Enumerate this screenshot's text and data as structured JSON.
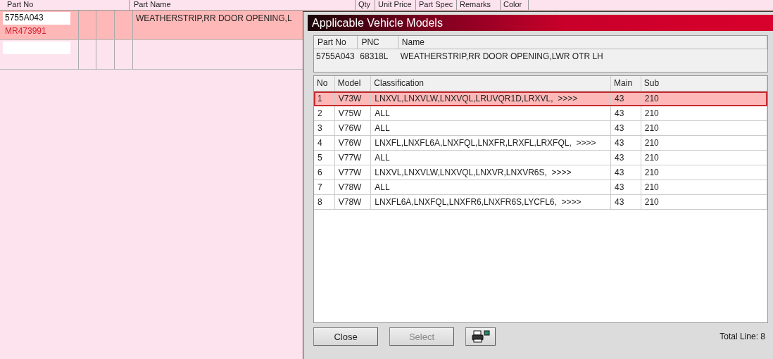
{
  "background_table": {
    "columns": [
      "Part No",
      "Part Name",
      "Qty",
      "Unit Price",
      "Part Spec",
      "Remarks",
      "Color"
    ],
    "rows": [
      {
        "part_no": "5755A043",
        "alt_part_no": "MR473991",
        "part_name": "WEATHERSTRIP,RR DOOR OPENING,L",
        "selected": true
      },
      {
        "selected": false
      }
    ]
  },
  "dialog": {
    "title": "Applicable Vehicle Models",
    "part_info": {
      "columns": [
        "Part No",
        "PNC",
        "Name"
      ],
      "values": [
        "5755A043",
        "68318L",
        "WEATHERSTRIP,RR DOOR OPENING,LWR OTR LH"
      ]
    },
    "grid": {
      "columns": [
        "No",
        "Model",
        "Classification",
        "Main",
        "Sub"
      ],
      "rows": [
        {
          "cells": [
            "1",
            "V73W",
            "LNXVL,LNXVLW,LNXVQL,LRUVQR1D,LRXVL,  >>>>",
            "43",
            "210"
          ],
          "selected": true
        },
        {
          "cells": [
            "2",
            "V75W",
            "ALL",
            "43",
            "210"
          ],
          "selected": false
        },
        {
          "cells": [
            "3",
            "V76W",
            "ALL",
            "43",
            "210"
          ],
          "selected": false
        },
        {
          "cells": [
            "4",
            "V76W",
            "LNXFL,LNXFL6A,LNXFQL,LNXFR,LRXFL,LRXFQL,  >>>>",
            "43",
            "210"
          ],
          "selected": false
        },
        {
          "cells": [
            "5",
            "V77W",
            "ALL",
            "43",
            "210"
          ],
          "selected": false
        },
        {
          "cells": [
            "6",
            "V77W",
            "LNXVL,LNXVLW,LNXVQL,LNXVR,LNXVR6S,  >>>>",
            "43",
            "210"
          ],
          "selected": false
        },
        {
          "cells": [
            "7",
            "V78W",
            "ALL",
            "43",
            "210"
          ],
          "selected": false
        },
        {
          "cells": [
            "8",
            "V78W",
            "LNXFL6A,LNXFQL,LNXFR6,LNXFR6S,LYCFL6,  >>>>",
            "43",
            "210"
          ],
          "selected": false
        }
      ]
    },
    "buttons": [
      {
        "label": "Close",
        "disabled": false
      },
      {
        "label": "Select",
        "disabled": true
      }
    ],
    "total": "Total Line: 8"
  }
}
